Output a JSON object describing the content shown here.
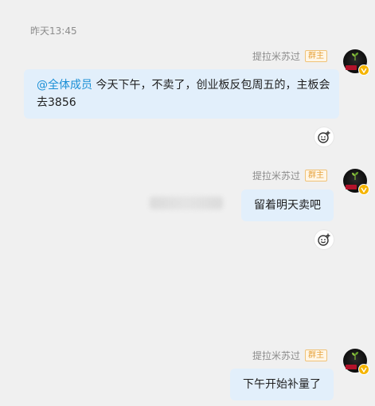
{
  "chat": {
    "timestamp": "昨天13:45",
    "messages": [
      {
        "sender": "提拉米苏过",
        "role": "群主",
        "mention": "@全体成员",
        "text": " 今天下午，不卖了，创业板反包周五的，主板会去3856"
      },
      {
        "sender": "提拉米苏过",
        "role": "群主",
        "text": "留着明天卖吧"
      },
      {
        "sender": "提拉米苏过",
        "role": "群主",
        "text": "下午开始补量了"
      }
    ]
  },
  "icons": {
    "reaction": "add-emoji-icon",
    "verified": "verified-badge-icon"
  },
  "colors": {
    "background": "#f0f0f0",
    "bubble": "#e2effb",
    "mention": "#1a8fd6",
    "role_badge": "#e6a23c"
  }
}
